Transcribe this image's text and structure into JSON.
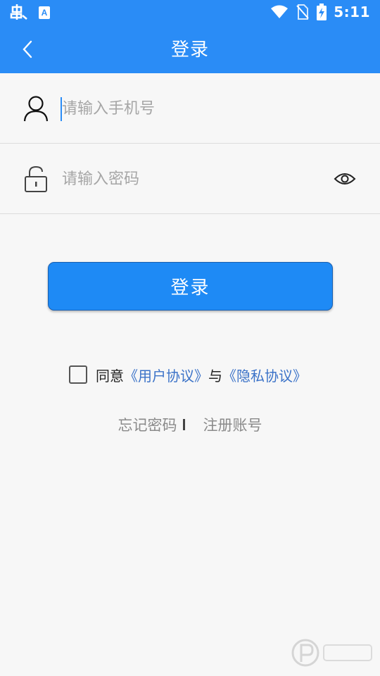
{
  "status_bar": {
    "time": "5:11",
    "left_icons": [
      "app-bug-icon",
      "a-text-icon"
    ],
    "right_icons": [
      "wifi-icon",
      "no-sim-icon",
      "battery-charging-icon"
    ]
  },
  "app_bar": {
    "title": "登录"
  },
  "phone_field": {
    "placeholder": "请输入手机号",
    "value": ""
  },
  "password_field": {
    "placeholder": "请输入密码",
    "value": ""
  },
  "login_button": {
    "label": "登录"
  },
  "agreement": {
    "prefix": "同意",
    "user_agreement": "《用户协议》",
    "conjunction": "与",
    "privacy_policy": "《隐私协议》",
    "checked": false
  },
  "links": {
    "forgot_password": "忘记密码",
    "register": "注册账号"
  },
  "colors": {
    "primary": "#2a8cf6",
    "button": "#1e8af5",
    "link": "#3c73c8",
    "background": "#f7f7f7"
  }
}
